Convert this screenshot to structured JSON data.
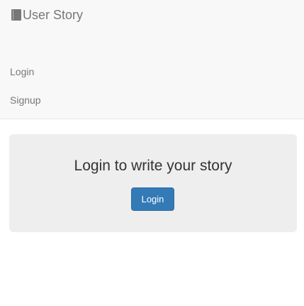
{
  "navbar": {
    "brand_icon": "book-icon",
    "brand_label": "User Story",
    "links": [
      {
        "label": "Login"
      },
      {
        "label": "Signup"
      }
    ]
  },
  "jumbotron": {
    "heading": "Login to write your story",
    "button_label": "Login"
  },
  "colors": {
    "navbar_bg": "#f8f8f8",
    "navbar_text": "#777777",
    "jumbotron_bg": "#eeeeee",
    "primary": "#337ab7"
  }
}
